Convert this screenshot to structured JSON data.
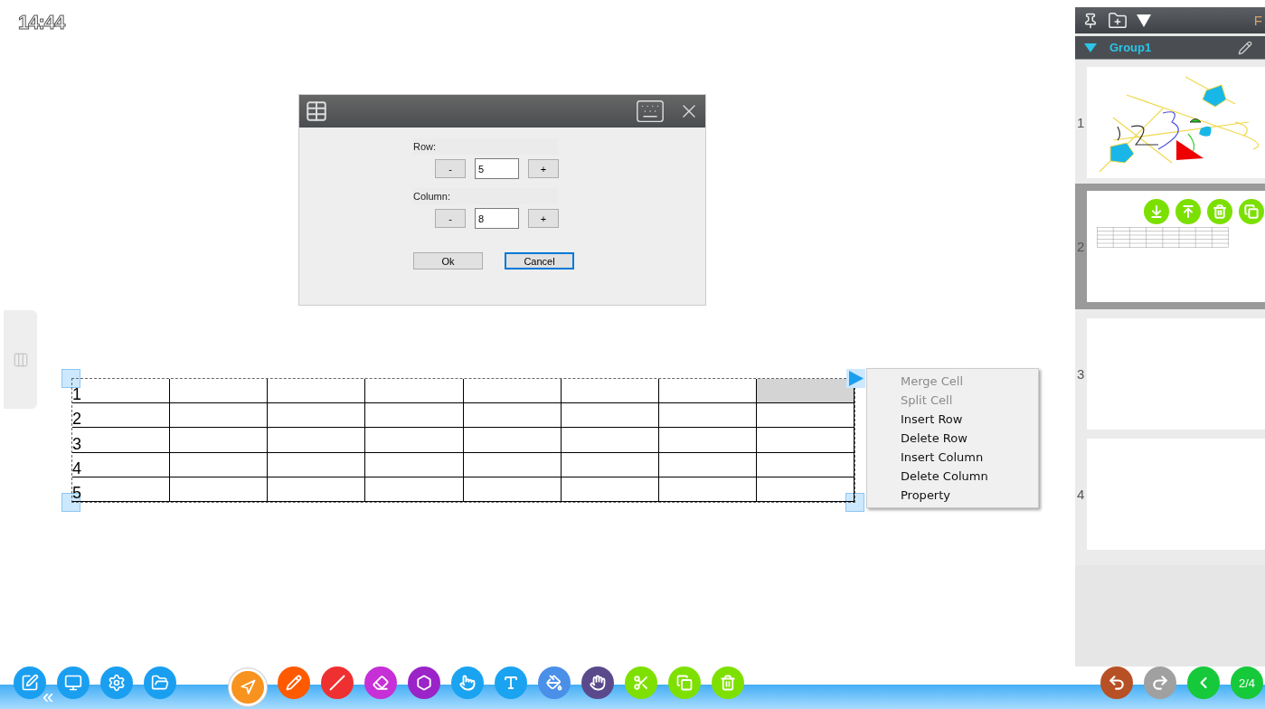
{
  "clock": "14:44",
  "side_tab": {
    "kind": "columns"
  },
  "dialog": {
    "row": {
      "label": "Row:",
      "minus": "-",
      "value": "5",
      "plus": "+"
    },
    "column": {
      "label": "Column:",
      "minus": "-",
      "value": "8",
      "plus": "+"
    },
    "buttons": [
      {
        "label": "Ok",
        "focused": false
      },
      {
        "label": "Cancel",
        "focused": true
      }
    ]
  },
  "table": {
    "rows": [
      {
        "label": "1",
        "cells": [
          {
            "selected": false
          },
          {
            "selected": false
          },
          {
            "selected": false
          },
          {
            "selected": false
          },
          {
            "selected": false
          },
          {
            "selected": false
          },
          {
            "selected": false
          },
          {
            "selected": true
          }
        ]
      },
      {
        "label": "2",
        "cells": [
          {
            "selected": false
          },
          {
            "selected": false
          },
          {
            "selected": false
          },
          {
            "selected": false
          },
          {
            "selected": false
          },
          {
            "selected": false
          },
          {
            "selected": false
          },
          {
            "selected": false
          }
        ]
      },
      {
        "label": "3",
        "cells": [
          {
            "selected": false
          },
          {
            "selected": false
          },
          {
            "selected": false
          },
          {
            "selected": false
          },
          {
            "selected": false
          },
          {
            "selected": false
          },
          {
            "selected": false
          },
          {
            "selected": false
          }
        ]
      },
      {
        "label": "4",
        "cells": [
          {
            "selected": false
          },
          {
            "selected": false
          },
          {
            "selected": false
          },
          {
            "selected": false
          },
          {
            "selected": false
          },
          {
            "selected": false
          },
          {
            "selected": false
          },
          {
            "selected": false
          }
        ]
      },
      {
        "label": "5",
        "cells": [
          {
            "selected": false
          },
          {
            "selected": false
          },
          {
            "selected": false
          },
          {
            "selected": false
          },
          {
            "selected": false
          },
          {
            "selected": false
          },
          {
            "selected": false
          },
          {
            "selected": false
          }
        ]
      }
    ]
  },
  "context_menu": {
    "items": [
      {
        "label": "Merge Cell",
        "disabled": true
      },
      {
        "label": "Split Cell",
        "disabled": true
      },
      {
        "label": "Insert Row",
        "disabled": false
      },
      {
        "label": "Delete Row",
        "disabled": false
      },
      {
        "label": "Insert Column",
        "disabled": false
      },
      {
        "label": "Delete Column",
        "disabled": false
      },
      {
        "label": "Property",
        "disabled": false
      }
    ]
  },
  "side_panel": {
    "header_text": "F",
    "group": {
      "name": "Group1",
      "expanded": true
    },
    "pages": [
      {
        "number": "1",
        "selected": false,
        "kind": "sketch"
      },
      {
        "number": "2",
        "selected": true,
        "kind": "table"
      },
      {
        "number": "3",
        "selected": false,
        "kind": "blank"
      },
      {
        "number": "4",
        "selected": false,
        "kind": "blank"
      }
    ]
  },
  "toolbar": {
    "collapse": "«",
    "left": [
      {
        "kind": "edit"
      },
      {
        "kind": "screen"
      },
      {
        "kind": "settings"
      },
      {
        "kind": "folder"
      }
    ],
    "tools": [
      {
        "kind": "pointer",
        "color": "#f7931e",
        "selected": true
      },
      {
        "kind": "pen",
        "color": "#ff5a00",
        "selected": false
      },
      {
        "kind": "line",
        "color": "#ee3030",
        "selected": false
      },
      {
        "kind": "eraser",
        "color": "#c630d6",
        "selected": false
      },
      {
        "kind": "shape",
        "color": "#9a24c8",
        "selected": false
      },
      {
        "kind": "touch",
        "color": "#1aa3f0",
        "selected": false
      },
      {
        "kind": "text",
        "color": "#1aa3f0",
        "selected": false
      },
      {
        "kind": "fill",
        "color": "#4a8fe8",
        "selected": false
      },
      {
        "kind": "hand",
        "color": "#5a4a8c",
        "selected": false
      },
      {
        "kind": "cut",
        "color": "#7ee000",
        "selected": false
      },
      {
        "kind": "copy",
        "color": "#7ee000",
        "selected": false
      },
      {
        "kind": "delete",
        "color": "#7ee000",
        "selected": false
      }
    ],
    "nav": [
      {
        "kind": "undo",
        "color": "#b85025"
      },
      {
        "kind": "redo",
        "color": "#a0a0a0"
      },
      {
        "kind": "back",
        "color": "#16c93a"
      }
    ],
    "page_indicator": "2/4"
  }
}
